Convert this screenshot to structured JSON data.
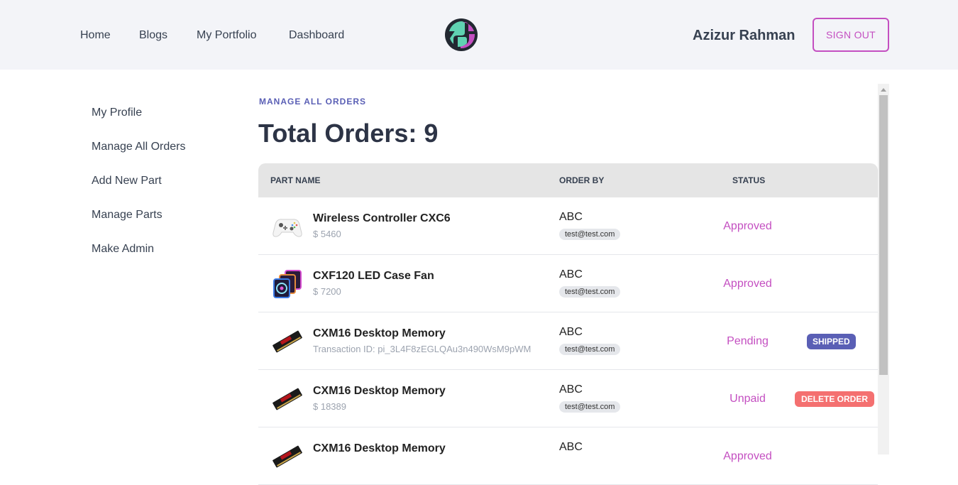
{
  "nav": {
    "links": [
      "Home",
      "Blogs",
      "My Portfolio",
      "Dashboard"
    ],
    "user_name": "Azizur Rahman",
    "signout_label": "SIGN OUT"
  },
  "sidebar": {
    "items": [
      "My Profile",
      "Manage All Orders",
      "Add New Part",
      "Manage Parts",
      "Make Admin"
    ]
  },
  "main": {
    "section_label": "MANAGE ALL ORDERS",
    "title": "Total Orders: 9",
    "table": {
      "headers": [
        "PART NAME",
        "ORDER BY",
        "STATUS"
      ],
      "rows": [
        {
          "part": "Wireless Controller CXC6",
          "sub": "$ 5460",
          "order_by": "ABC",
          "email": "test@test.com",
          "status": "Approved",
          "action": "",
          "icon": "controller-icon"
        },
        {
          "part": "CXF120 LED Case Fan",
          "sub": "$ 7200",
          "order_by": "ABC",
          "email": "test@test.com",
          "status": "Approved",
          "action": "",
          "icon": "case-fan-icon"
        },
        {
          "part": "CXM16 Desktop Memory",
          "sub": "Transaction ID: pi_3L4F8zEGLQAu3n490WsM9pWM",
          "order_by": "ABC",
          "email": "test@test.com",
          "status": "Pending",
          "action": "SHIPPED",
          "icon": "memory-icon"
        },
        {
          "part": "CXM16 Desktop Memory",
          "sub": "$ 18389",
          "order_by": "ABC",
          "email": "test@test.com",
          "status": "Unpaid",
          "action": "DELETE ORDER",
          "icon": "memory-icon"
        },
        {
          "part": "CXM16 Desktop Memory",
          "sub": "",
          "order_by": "ABC",
          "email": "",
          "status": "Approved",
          "action": "",
          "icon": "memory-icon"
        }
      ]
    }
  },
  "colors": {
    "accent": "#c44fc1",
    "primary": "#5a5fb5",
    "danger": "#f47070",
    "header_bg": "#f3f4f8"
  }
}
